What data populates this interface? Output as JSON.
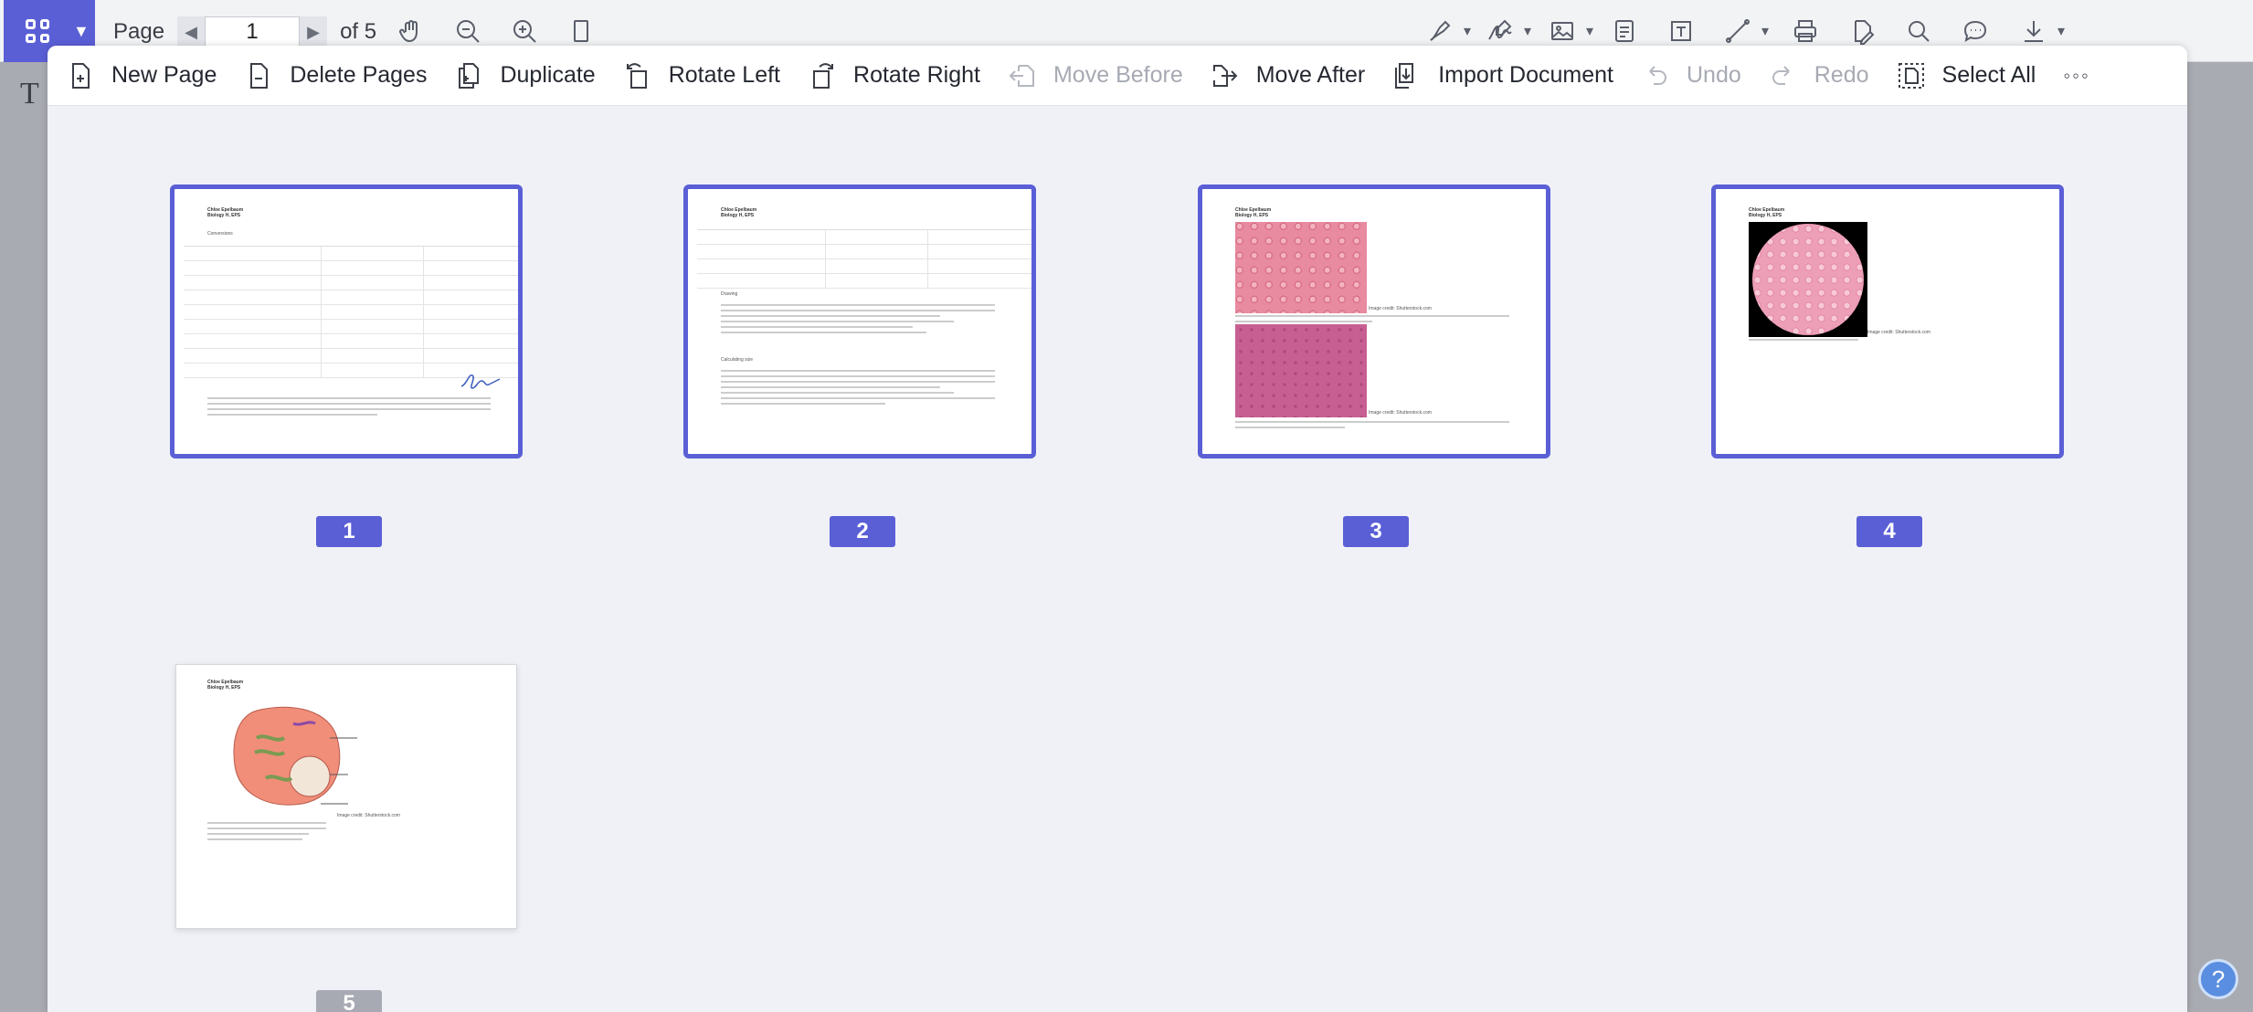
{
  "app": {
    "page_label": "Page",
    "current_page": "1",
    "of_total": "of 5",
    "text_tool_glyph": "T",
    "help_glyph": "?"
  },
  "top_icons": [
    "hand-icon",
    "zoom-out-icon",
    "zoom-in-icon",
    "single-page-icon",
    "pen-icon",
    "signature-icon",
    "image-icon",
    "note-icon",
    "text-box-icon",
    "line-icon",
    "print-icon",
    "edit-icon",
    "search-icon",
    "comment-icon",
    "download-icon"
  ],
  "organizer_toolbar": [
    {
      "label": "New Page",
      "icon": "new-page-icon",
      "enabled": true
    },
    {
      "label": "Delete Pages",
      "icon": "delete-pages-icon",
      "enabled": true
    },
    {
      "label": "Duplicate",
      "icon": "duplicate-icon",
      "enabled": true
    },
    {
      "label": "Rotate Left",
      "icon": "rotate-left-icon",
      "enabled": true
    },
    {
      "label": "Rotate Right",
      "icon": "rotate-right-icon",
      "enabled": true
    },
    {
      "label": "Move Before",
      "icon": "move-before-icon",
      "enabled": false
    },
    {
      "label": "Move After",
      "icon": "move-after-icon",
      "enabled": true
    },
    {
      "label": "Import Document",
      "icon": "import-document-icon",
      "enabled": true
    },
    {
      "label": "Undo",
      "icon": "undo-icon",
      "enabled": false
    },
    {
      "label": "Redo",
      "icon": "redo-icon",
      "enabled": false
    },
    {
      "label": "Select All",
      "icon": "select-all-icon",
      "enabled": true
    },
    {
      "label": "◦◦◦",
      "icon": "more-icon",
      "enabled": true
    }
  ],
  "pages": [
    {
      "number": "1",
      "selected": true,
      "author": "Chloe Epelbaum",
      "course": "Biology H, EPS",
      "heading": "Conversions"
    },
    {
      "number": "2",
      "selected": true,
      "author": "Chloe Epelbaum",
      "course": "Biology H, EPS",
      "heading": "Drawing",
      "heading2": "Calculating size"
    },
    {
      "number": "3",
      "selected": true,
      "author": "Chloe Epelbaum",
      "course": "Biology H, EPS",
      "credit": "Image credit: Shutterstock.com"
    },
    {
      "number": "4",
      "selected": true,
      "author": "Chloe Epelbaum",
      "course": "Biology H, EPS",
      "credit": "Image credit: Shutterstock.com"
    },
    {
      "number": "5",
      "selected": false,
      "author": "Chloe Epelbaum",
      "course": "Biology H, EPS",
      "credit": "Image credit: Shutterstock.com"
    }
  ],
  "colors": {
    "accent": "#5a5fd6",
    "panel_bg": "#eff1f7",
    "disabled": "#a7aab3"
  }
}
